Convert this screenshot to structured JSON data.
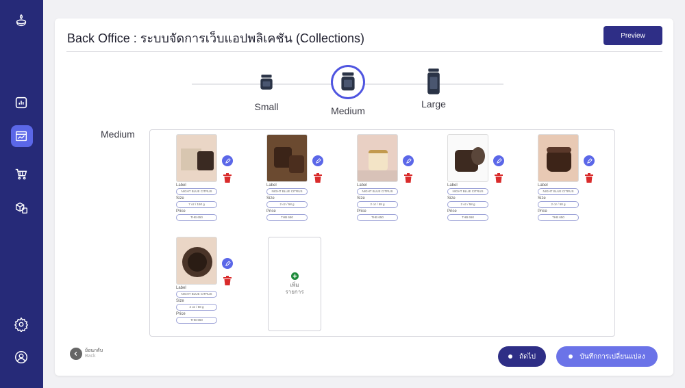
{
  "header": {
    "title": "Back Office : ระบบจัดการเว็บแอปพลิเคชัน (Collections)",
    "preview_label": "Preview"
  },
  "sidebar": {
    "icons": [
      "logo-icon",
      "dashboard-icon",
      "web-layout-icon",
      "cart-icon",
      "inventory-icon",
      "settings-icon",
      "profile-icon"
    ],
    "active": "web-layout-icon"
  },
  "sizes": {
    "options": [
      "Small",
      "Medium",
      "Large"
    ],
    "selected": "Medium"
  },
  "section": {
    "label": "Medium"
  },
  "fields": {
    "label": "Label",
    "size": "Size",
    "price": "Price"
  },
  "products": [
    {
      "label": "NIGHT BLUE CITRUS",
      "size": "7 oz / 150 g",
      "price": "THB 650"
    },
    {
      "label": "NIGHT BLUE CITRUS",
      "size": "2 oz / 58 g",
      "price": "THB 650"
    },
    {
      "label": "NIGHT BLUE CITRUS",
      "size": "2 oz / 58 g",
      "price": "THB 650"
    },
    {
      "label": "NIGHT BLUE CITRUS",
      "size": "2 oz / 58 g",
      "price": "THB 650"
    },
    {
      "label": "NIGHT BLUE CITRUS",
      "size": "2 oz / 58 g",
      "price": "THB 650"
    },
    {
      "label": "NIGHT BLUE CITRUS",
      "size": "2 oz / 58 g",
      "price": "THB 650"
    }
  ],
  "add_item": {
    "line1": "เพิ่ม",
    "line2": "รายการ"
  },
  "footer": {
    "back_label": "ย้อนกลับ",
    "back_sub": "Back",
    "next_label": "ถัดไป",
    "save_label": "บันทึกการเปลี่ยนแปลง"
  },
  "colors": {
    "sidebar": "#262a78",
    "primary": "#2e2e86",
    "accent": "#5b67e8",
    "delete": "#d92b2b"
  }
}
